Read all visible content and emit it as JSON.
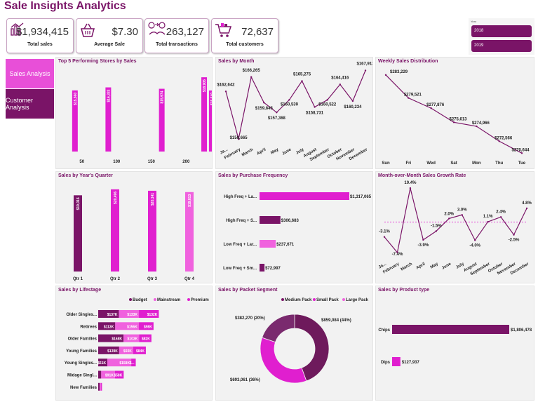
{
  "title": "Sale Insights Analytics",
  "colors": {
    "dark": "#7a1467",
    "magenta": "#e01fcf",
    "light": "#f062de",
    "pink": "#f3a6ea"
  },
  "kpis": [
    {
      "value": "$1,934,415",
      "label": "Total sales",
      "icon": "sales-chart-icon"
    },
    {
      "value": "$7.30",
      "label": "Average Sale",
      "icon": "shopping-basket-icon"
    },
    {
      "value": "263,127",
      "label": "Total transactions",
      "icon": "money-exchange-icon"
    },
    {
      "value": "72,637",
      "label": "Total customers",
      "icon": "shopping-cart-icon"
    }
  ],
  "nav": {
    "sales": "Sales Analysis",
    "customer": "Customer Analysis"
  },
  "slicer": {
    "title": "Year",
    "options": [
      "2018",
      "2019"
    ]
  },
  "chart_data": [
    {
      "id": "top-stores",
      "type": "bar",
      "title": "Top 5 Performing Stores by Sales",
      "x_ticks": [
        "50",
        "100",
        "150",
        "200"
      ],
      "x_range": [
        25,
        230
      ],
      "x": [
        40,
        88,
        165,
        226,
        237
      ],
      "values": [
        15560,
        16333,
        15974,
        18905,
        15540
      ],
      "labels": [
        "$15,560",
        "$16,333",
        "$15,974",
        "$18,905",
        "$15,540"
      ]
    },
    {
      "id": "sales-month",
      "type": "line",
      "title": "Sales by Month",
      "categories": [
        "Ja...",
        "February",
        "March",
        "April",
        "May",
        "June",
        "July",
        "August",
        "September",
        "October",
        "November",
        "December"
      ],
      "values": [
        162642,
        150665,
        166265,
        159845,
        157368,
        160539,
        165275,
        158731,
        160522,
        164416,
        160234,
        167913
      ],
      "labels": [
        "$162,642",
        "$150,665",
        "$166,265",
        "$159,845",
        "$157,368",
        "$160,539",
        "$165,275",
        "$158,731",
        "$160,522",
        "$164,416",
        "$160,234",
        "$167,913"
      ]
    },
    {
      "id": "weekly",
      "type": "line",
      "title": "Weekly Sales Distribution",
      "categories": [
        "Sun",
        "Fri",
        "Wed",
        "Sat",
        "Mon",
        "Thu",
        "Tue"
      ],
      "values": [
        283229,
        279521,
        277876,
        275613,
        274966,
        272566,
        270644
      ],
      "labels": [
        "$283,229",
        "$279,521",
        "$277,876",
        "$275,613",
        "$274,966",
        "$272,566",
        "$270,644"
      ]
    },
    {
      "id": "quarter",
      "type": "bar",
      "title": "Sales by Year's Quarter",
      "categories": [
        "Qtr 1",
        "Qtr 2",
        "Qtr 3",
        "Qtr 4"
      ],
      "values": [
        19016,
        20496,
        20141,
        19813
      ],
      "labels": [
        "$19,016",
        "$20,496",
        "$20,141",
        "$19,813"
      ]
    },
    {
      "id": "purchase-freq",
      "type": "bar",
      "title": "Sales by Purchase Frequency",
      "categories": [
        "High Freq + La...",
        "High Freq + S...",
        "Low Freq + Lar...",
        "Low Freq + Sm..."
      ],
      "values": [
        1317065,
        306683,
        237671,
        72997
      ],
      "labels": [
        "$1,317,065",
        "$306,683",
        "$237,671",
        "$72,997"
      ]
    },
    {
      "id": "mom-growth",
      "type": "line",
      "title": "Month-over-Month Sales Growth Rate",
      "categories": [
        "Ja...",
        "February",
        "March",
        "April",
        "May",
        "June",
        "July",
        "August",
        "September",
        "October",
        "November",
        "December"
      ],
      "values": [
        -3.1,
        -7.4,
        10.4,
        -3.9,
        -1.5,
        2.0,
        3.0,
        -4.0,
        1.1,
        2.4,
        -2.5,
        4.8
      ],
      "labels": [
        "-3.1%",
        "-7.4%",
        "10.4%",
        "-3.9%",
        "-1.5%",
        "2.0%",
        "3.0%",
        "-4.0%",
        "1.1%",
        "2.4%",
        "-2.5%",
        "4.8%"
      ]
    },
    {
      "id": "lifestage",
      "type": "bar",
      "title": "Sales by Lifestage",
      "legend": [
        "Budget",
        "Mainstream",
        "Premium"
      ],
      "categories": [
        "Older Singles...",
        "Retirees",
        "Older Families",
        "Young Families",
        "Young Singles...",
        "Midage Singl...",
        "New Families"
      ],
      "series": [
        {
          "name": "Budget",
          "values": [
            137,
            113,
            168,
            139,
            61,
            20,
            10
          ],
          "labels": [
            "$137K",
            "$113K",
            "$168K",
            "$139K",
            "$61K",
            "",
            ""
          ]
        },
        {
          "name": "Mainstream",
          "values": [
            133,
            156,
            103,
            93,
            158,
            91,
            9
          ],
          "labels": [
            "$133K",
            "$156K",
            "$103K",
            "$93K",
            "$158K",
            "$91K",
            ""
          ]
        },
        {
          "name": "Premium",
          "values": [
            132,
            98,
            82,
            84,
            30,
            58,
            6
          ],
          "labels": [
            "$132K",
            "$98K",
            "$82K",
            "$84K",
            "$...",
            "$58K",
            ""
          ]
        }
      ]
    },
    {
      "id": "packet",
      "type": "pie",
      "title": "Sales by Packet Segment",
      "legend": [
        "Medium Pack",
        "Small Pack",
        "Large Pack"
      ],
      "values": [
        859084,
        693061,
        382270
      ],
      "labels": [
        "$859,084 (44%)",
        "$693,061 (36%)",
        "$382,270 (20%)"
      ]
    },
    {
      "id": "product",
      "type": "bar",
      "title": "Sales by Product type",
      "categories": [
        "Chips",
        "Dips"
      ],
      "values": [
        1806478,
        127937
      ],
      "labels": [
        "$1,806,478",
        "$127,937"
      ]
    }
  ]
}
